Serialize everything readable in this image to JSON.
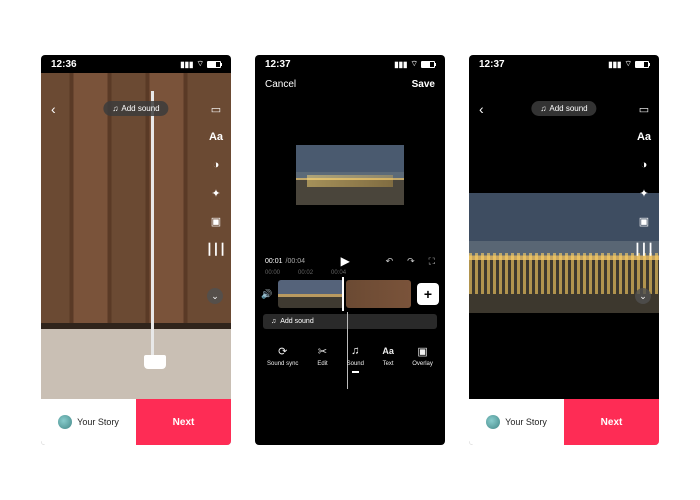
{
  "screens": [
    {
      "time": "12:36",
      "battery": "66",
      "add_sound": "Add sound",
      "tools": [
        "flip",
        "Aa",
        "timer",
        "smile",
        "crop",
        "adjust"
      ],
      "story": "Your Story",
      "next": "Next"
    },
    {
      "time": "12:37",
      "battery": "56",
      "cancel": "Cancel",
      "save": "Save",
      "pos": "00:01",
      "dur": "/00:04",
      "ticks": [
        "00:00",
        "00:02",
        "00:04"
      ],
      "add_sound": "Add sound",
      "tools": [
        {
          "icon": "⟳",
          "label": "Sound sync"
        },
        {
          "icon": "✂",
          "label": "Edit"
        },
        {
          "icon": "♫",
          "label": "Sound"
        },
        {
          "icon": "Aa",
          "label": "Text"
        },
        {
          "icon": "▣",
          "label": "Overlay"
        }
      ]
    },
    {
      "time": "12:37",
      "battery": "56",
      "add_sound": "Add sound",
      "tools": [
        "flip",
        "Aa",
        "timer",
        "smile",
        "crop",
        "adjust"
      ],
      "story": "Your Story",
      "next": "Next"
    }
  ]
}
